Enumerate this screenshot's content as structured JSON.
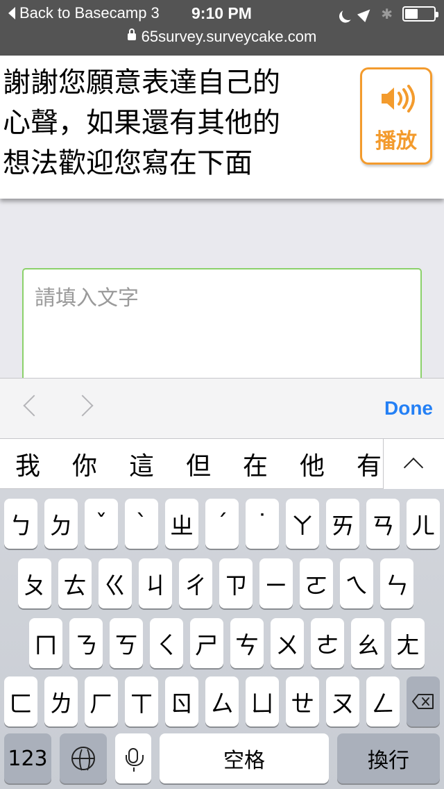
{
  "status_bar": {
    "back_label": "Back to Basecamp 3",
    "time": "9:10 PM",
    "bluetooth_glyph": "✱",
    "url": "65survey.surveycake.com"
  },
  "question": {
    "text": "謝謝您願意表達自己的心聲，如果還有其他的想法歡迎您寫在下面",
    "line1": "謝謝您願意表達自己的",
    "line2": "心聲，如果還有其他的",
    "line3": "想法歡迎您寫在下面",
    "play_label": "播放",
    "accent_color": "#f39b2d"
  },
  "answer": {
    "placeholder": "請填入文字",
    "border_color": "#8bd16a"
  },
  "accessory": {
    "done_label": "Done",
    "done_color": "#2480f5"
  },
  "candidates": [
    "我",
    "你",
    "這",
    "但",
    "在",
    "他",
    "有"
  ],
  "keyboard": {
    "row1": [
      "ㄅ",
      "ㄉ",
      "ˇ",
      "ˋ",
      "ㄓ",
      "ˊ",
      "˙",
      "ㄚ",
      "ㄞ",
      "ㄢ",
      "ㄦ"
    ],
    "row2": [
      "ㄆ",
      "ㄊ",
      "ㄍ",
      "ㄐ",
      "ㄔ",
      "ㄗ",
      "ㄧ",
      "ㄛ",
      "ㄟ",
      "ㄣ"
    ],
    "row3": [
      "ㄇ",
      "ㄋ",
      "ㄎ",
      "ㄑ",
      "ㄕ",
      "ㄘ",
      "ㄨ",
      "ㄜ",
      "ㄠ",
      "ㄤ"
    ],
    "row4": [
      "ㄈ",
      "ㄌ",
      "ㄏ",
      "ㄒ",
      "ㄖ",
      "ㄙ",
      "ㄩ",
      "ㄝ",
      "ㄡ",
      "ㄥ"
    ],
    "numbers_label": "123",
    "space_label": "空格",
    "return_label": "換行"
  }
}
